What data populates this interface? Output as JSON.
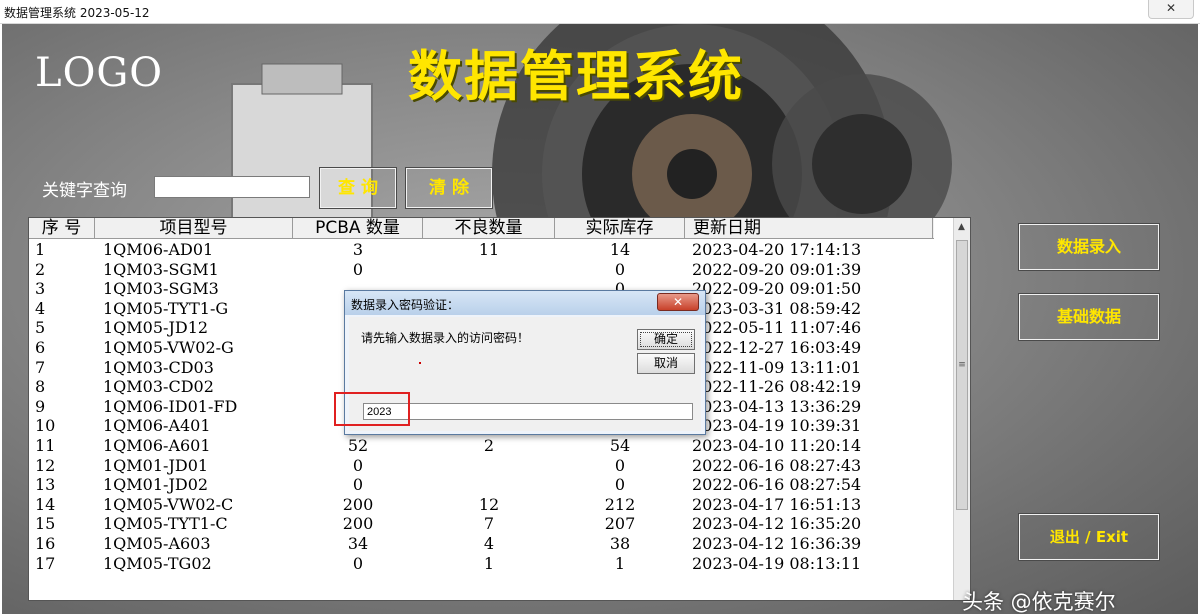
{
  "window": {
    "title": "数据管理系统 2023-05-12",
    "close_label": "✕"
  },
  "header": {
    "logo": "LOGO",
    "app_title": "数据管理系统"
  },
  "search": {
    "label": "关键字查询",
    "value": "",
    "search_button": "查 询",
    "clear_button": "清 除"
  },
  "side_buttons": {
    "entry": "数据录入",
    "base": "基础数据",
    "exit": "退出 / Exit"
  },
  "table": {
    "columns": [
      "序 号",
      "项目型号",
      "PCBA 数量",
      "不良数量",
      "实际库存",
      "更新日期"
    ],
    "rows": [
      [
        "1",
        "1QM06-AD01",
        "3",
        "11",
        "14",
        "2023-04-20  17:14:13"
      ],
      [
        "2",
        "1QM03-SGM1",
        "0",
        "",
        "0",
        "2022-09-20  09:01:39"
      ],
      [
        "3",
        "1QM03-SGM3",
        "",
        "",
        "0",
        "2022-09-20  09:01:50"
      ],
      [
        "4",
        "1QM05-TYT1-G",
        "",
        "",
        "",
        "2023-03-31  08:59:42"
      ],
      [
        "5",
        "1QM05-JD12",
        "",
        "",
        "",
        "2022-05-11  11:07:46"
      ],
      [
        "6",
        "1QM05-VW02-G",
        "",
        "",
        "",
        "2022-12-27  16:03:49"
      ],
      [
        "7",
        "1QM03-CD03",
        "",
        "",
        "",
        "2022-11-09  13:11:01"
      ],
      [
        "8",
        "1QM03-CD02",
        "",
        "",
        "",
        "2022-11-26  08:42:19"
      ],
      [
        "9",
        "1QM06-ID01-FD",
        "",
        "",
        "",
        "2023-04-13  13:36:29"
      ],
      [
        "10",
        "1QM06-A401",
        "",
        "",
        "",
        "2023-04-19  10:39:31"
      ],
      [
        "11",
        "1QM06-A601",
        "52",
        "2",
        "54",
        "2023-04-10  11:20:14"
      ],
      [
        "12",
        "1QM01-JD01",
        "0",
        "",
        "0",
        "2022-06-16  08:27:43"
      ],
      [
        "13",
        "1QM01-JD02",
        "0",
        "",
        "0",
        "2022-06-16  08:27:54"
      ],
      [
        "14",
        "1QM05-VW02-C",
        "200",
        "12",
        "212",
        "2023-04-17  16:51:13"
      ],
      [
        "15",
        "1QM05-TYT1-C",
        "200",
        "7",
        "207",
        "2023-04-12  16:35:20"
      ],
      [
        "16",
        "1QM05-A603",
        "34",
        "4",
        "38",
        "2023-04-12  16:36:39"
      ],
      [
        "17",
        "1QM05-TG02",
        "0",
        "1",
        "1",
        "2023-04-19  08:13:11"
      ]
    ]
  },
  "dialog": {
    "title": "数据录入密码验证：",
    "close_label": "✕",
    "message": "请先输入数据录入的访问密码！",
    "ok_button": "确定",
    "cancel_button": "取消",
    "password_value": "2023"
  },
  "watermark": "头条 @依克赛尔",
  "colors": {
    "accent_yellow": "#ffe600",
    "highlight_red": "#e02020"
  }
}
